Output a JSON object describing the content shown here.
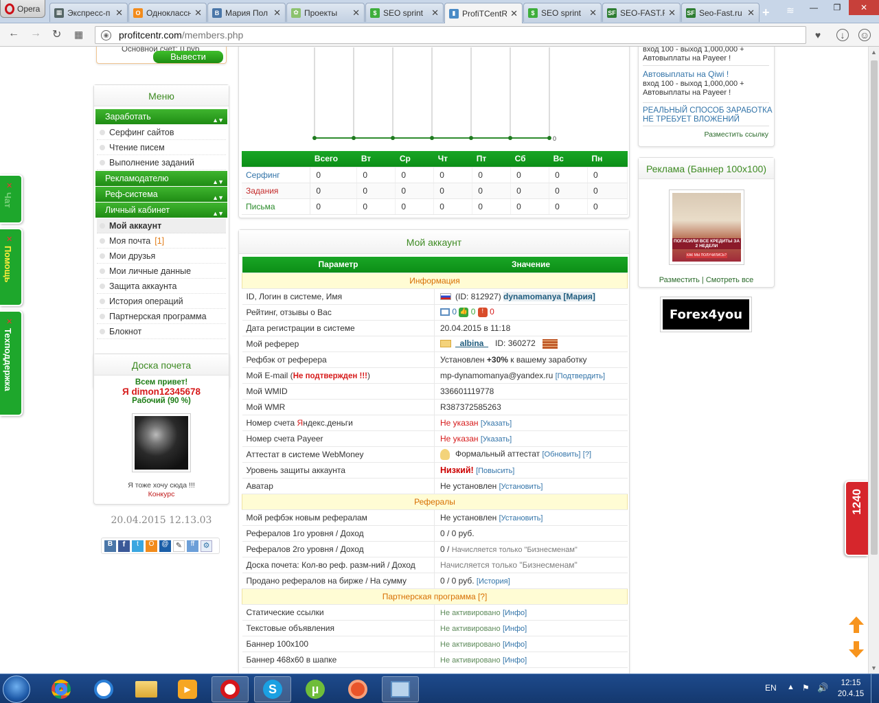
{
  "browser": {
    "opera_label": "Opera",
    "tabs": [
      {
        "label": "Экспресс-п",
        "fav": "grid"
      },
      {
        "label": "Одноклассн",
        "fav": "ok"
      },
      {
        "label": "Мария Пол",
        "fav": "vk"
      },
      {
        "label": "Проекты",
        "fav": "proj"
      },
      {
        "label": "SEO sprint",
        "fav": "seo"
      },
      {
        "label": "ProfiTCentR",
        "fav": "pc",
        "active": true
      },
      {
        "label": "SEO sprint",
        "fav": "seo"
      },
      {
        "label": "SEO-FAST.R",
        "fav": "sf"
      },
      {
        "label": "Seo-Fast.ru",
        "fav": "sf"
      }
    ],
    "url_domain": "profitcentr.com",
    "url_path": "/members.php"
  },
  "balance": {
    "text": "Основной счет: 0 руб",
    "withdraw": "Вывести"
  },
  "menu": {
    "title": "Меню",
    "earn": "Заработать",
    "surfing": "Серфинг сайтов",
    "mail": "Чтение писем",
    "tasks": "Выполнение заданий",
    "advertiser": "Рекламодателю",
    "ref": "Реф-система",
    "cabinet": "Личный кабинет",
    "my_account": "Мой аккаунт",
    "my_mail": "Моя почта",
    "my_mail_count": "[1]",
    "friends": "Мои друзья",
    "personal": "Мои личные данные",
    "protect": "Защита аккаунта",
    "history": "История операций",
    "partner": "Партнерская программа",
    "notepad": "Блокнот"
  },
  "honor": {
    "title": "Доска почета",
    "hello": "Всем привет!",
    "user": "Я dimon12345678",
    "status": "Рабочий (90 %)",
    "want": "Я тоже хочу сюда !!!",
    "contest": "Конкурс"
  },
  "datetime": "20.04.2015 12.13.03",
  "chart_data": {
    "type": "line",
    "categories": [
      "",
      "",
      "",
      "",
      "",
      "",
      ""
    ],
    "values": [
      0,
      0,
      0,
      0,
      0,
      0,
      0
    ],
    "ytick": "0"
  },
  "stats": {
    "headers": [
      "",
      "Всего",
      "Вт",
      "Ср",
      "Чт",
      "Пт",
      "Сб",
      "Вс",
      "Пн"
    ],
    "rows": [
      {
        "label": "Серфинг",
        "v": [
          "0",
          "0",
          "0",
          "0",
          "0",
          "0",
          "0",
          "0"
        ]
      },
      {
        "label": "Задания",
        "v": [
          "0",
          "0",
          "0",
          "0",
          "0",
          "0",
          "0",
          "0"
        ]
      },
      {
        "label": "Письма",
        "v": [
          "0",
          "0",
          "0",
          "0",
          "0",
          "0",
          "0",
          "0"
        ]
      }
    ]
  },
  "account": {
    "title": "Мой аккаунт",
    "col_param": "Параметр",
    "col_value": "Значение",
    "sec_info": "Информация",
    "r_id": "ID, Логин в системе, Имя",
    "v_id_pre": "(ID: 812927)",
    "v_id_login": "dynamomanya [Мария]",
    "r_rating": "Рейтинг, отзывы о Вас",
    "v_rating": [
      "0",
      "0",
      "0"
    ],
    "r_reg": "Дата регистрации в системе",
    "v_reg": "20.04.2015 в 11:18",
    "r_referer": "Мой реферер",
    "v_referer": "_albina_",
    "v_referer_id": "ID: 360272",
    "r_refback": "Рефбэк от реферера",
    "v_refback_a": "Установлен",
    "v_refback_b": "+30%",
    "v_refback_c": "к вашему заработку",
    "r_email_a": "Мой E-mail (",
    "r_email_b": "Не подтвержден !!!",
    "r_email_c": ")",
    "v_email": "mp-dynamomanya@yandex.ru",
    "v_email_link": "[Подтвердить]",
    "r_wmid": "Мой WMID",
    "v_wmid": "336601119778",
    "r_wmr": "Мой WMR",
    "v_wmr": "R387372585263",
    "r_yandex_a": "Номер счета ",
    "r_yandex_b": "Я",
    "r_yandex_c": "ндекс.деньги",
    "v_notset": "Не указан",
    "v_set_link": "[Указать]",
    "r_payeer": "Номер счета Payeer",
    "r_attest": "Аттестат в системе WebMoney",
    "v_attest": "Формальный аттестат",
    "v_attest_link": "[Обновить]",
    "v_q": "[?]",
    "r_level": "Уровень защиты аккаунта",
    "v_level": "Низкий!",
    "v_level_link": "[Повысить]",
    "r_avatar": "Аватар",
    "v_avatar": "Не установлен",
    "v_install_link": "[Установить]",
    "sec_refs": "Рефералы",
    "r_myrefback": "Мой рефбэк новым рефералам",
    "r_l1": "Рефералов 1го уровня / Доход",
    "v_l1": "0 / 0 руб.",
    "r_l2": "Рефералов 2го уровня / Доход",
    "v_l2": "0 / ",
    "v_biz": "Начисляется только \"Бизнесменам\"",
    "r_honor": "Доска почета: Кол-во реф. разм-ний / Доход",
    "r_sold": "Продано рефералов на бирже / На сумму",
    "v_sold": "0 / 0 руб.",
    "v_history": "[История]",
    "sec_partner": "Партнерская программа [?]",
    "r_static": "Статические ссылки",
    "r_text": "Текстовые объявления",
    "r_b100": "Баннер 100х100",
    "r_b468": "Баннер 468х60 в шапке",
    "v_notact": "Не активировано",
    "v_info": "[Инфо]"
  },
  "ads": {
    "line1": "вход 100 - выход 1,000,000 +",
    "line2": "Автовыплаты на Payeer !",
    "qiwi": "Автовыплаты на Qiwi !",
    "qiwi2": "вход 100 - выход 1,000,000 +",
    "qiwi3": "Автовыплаты на Payeer !",
    "real1": "РЕАЛЬНЫЙ СПОСОБ ЗАРАБОТКА",
    "real2": "НЕ ТРЕБУЕТ ВЛОЖЕНИЙ",
    "place": "Разместить ссылку",
    "banner_title": "Реклама (Баннер 100х100)",
    "banner_text": "ПОГАСИЛИ ВСЕ КРЕДИТЫ ЗА 2 НЕДЕЛИ",
    "banner_btn": "КАК МЫ ПОЛУЧИЛИСЬ?",
    "place2": "Разместить",
    "see_all": "Смотреть все",
    "forex": "Forex4you"
  },
  "side": {
    "chat": "Чат",
    "help": "Помощь",
    "support": "Техподдержка",
    "counter": "1240"
  },
  "tray": {
    "lang": "EN",
    "time": "12:15",
    "date": "20.4.15"
  },
  "colors": {
    "accent": "#1e9a22",
    "title_green": "#3d8a22",
    "link": "#3173a8",
    "warning": "#d61a1a"
  }
}
